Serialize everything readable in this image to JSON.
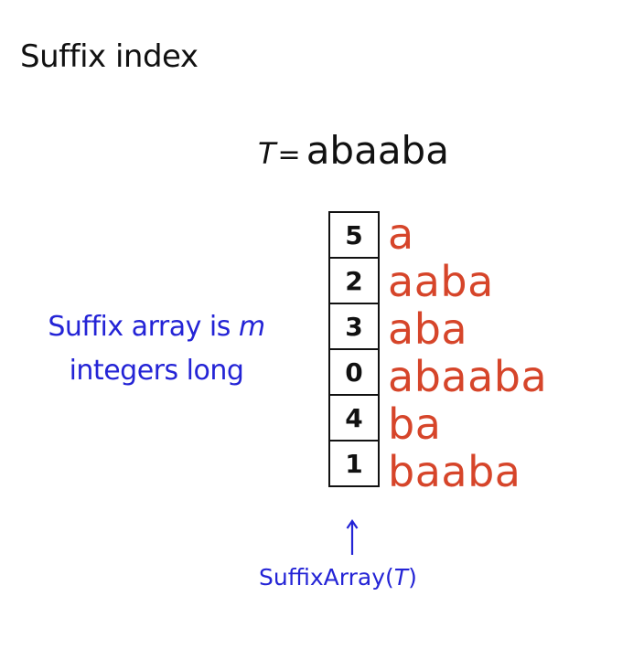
{
  "title": "Suffix index",
  "text_var": "T",
  "text_eq": "=",
  "text_value": "abaaba",
  "caption": {
    "line1_prefix": "Suffix array is ",
    "line1_var": "m",
    "line2": "integers long"
  },
  "suffix_array": [
    "5",
    "2",
    "3",
    "0",
    "4",
    "1"
  ],
  "suffixes": [
    "a",
    "aaba",
    "aba",
    "abaaba",
    "ba",
    "baaba"
  ],
  "sa_label": {
    "prefix": "SuffixArray(",
    "var": "T",
    "suffix": ")"
  },
  "colors": {
    "suffix_text": "#d6452a",
    "annotation": "#2424d6",
    "text": "#111111"
  }
}
